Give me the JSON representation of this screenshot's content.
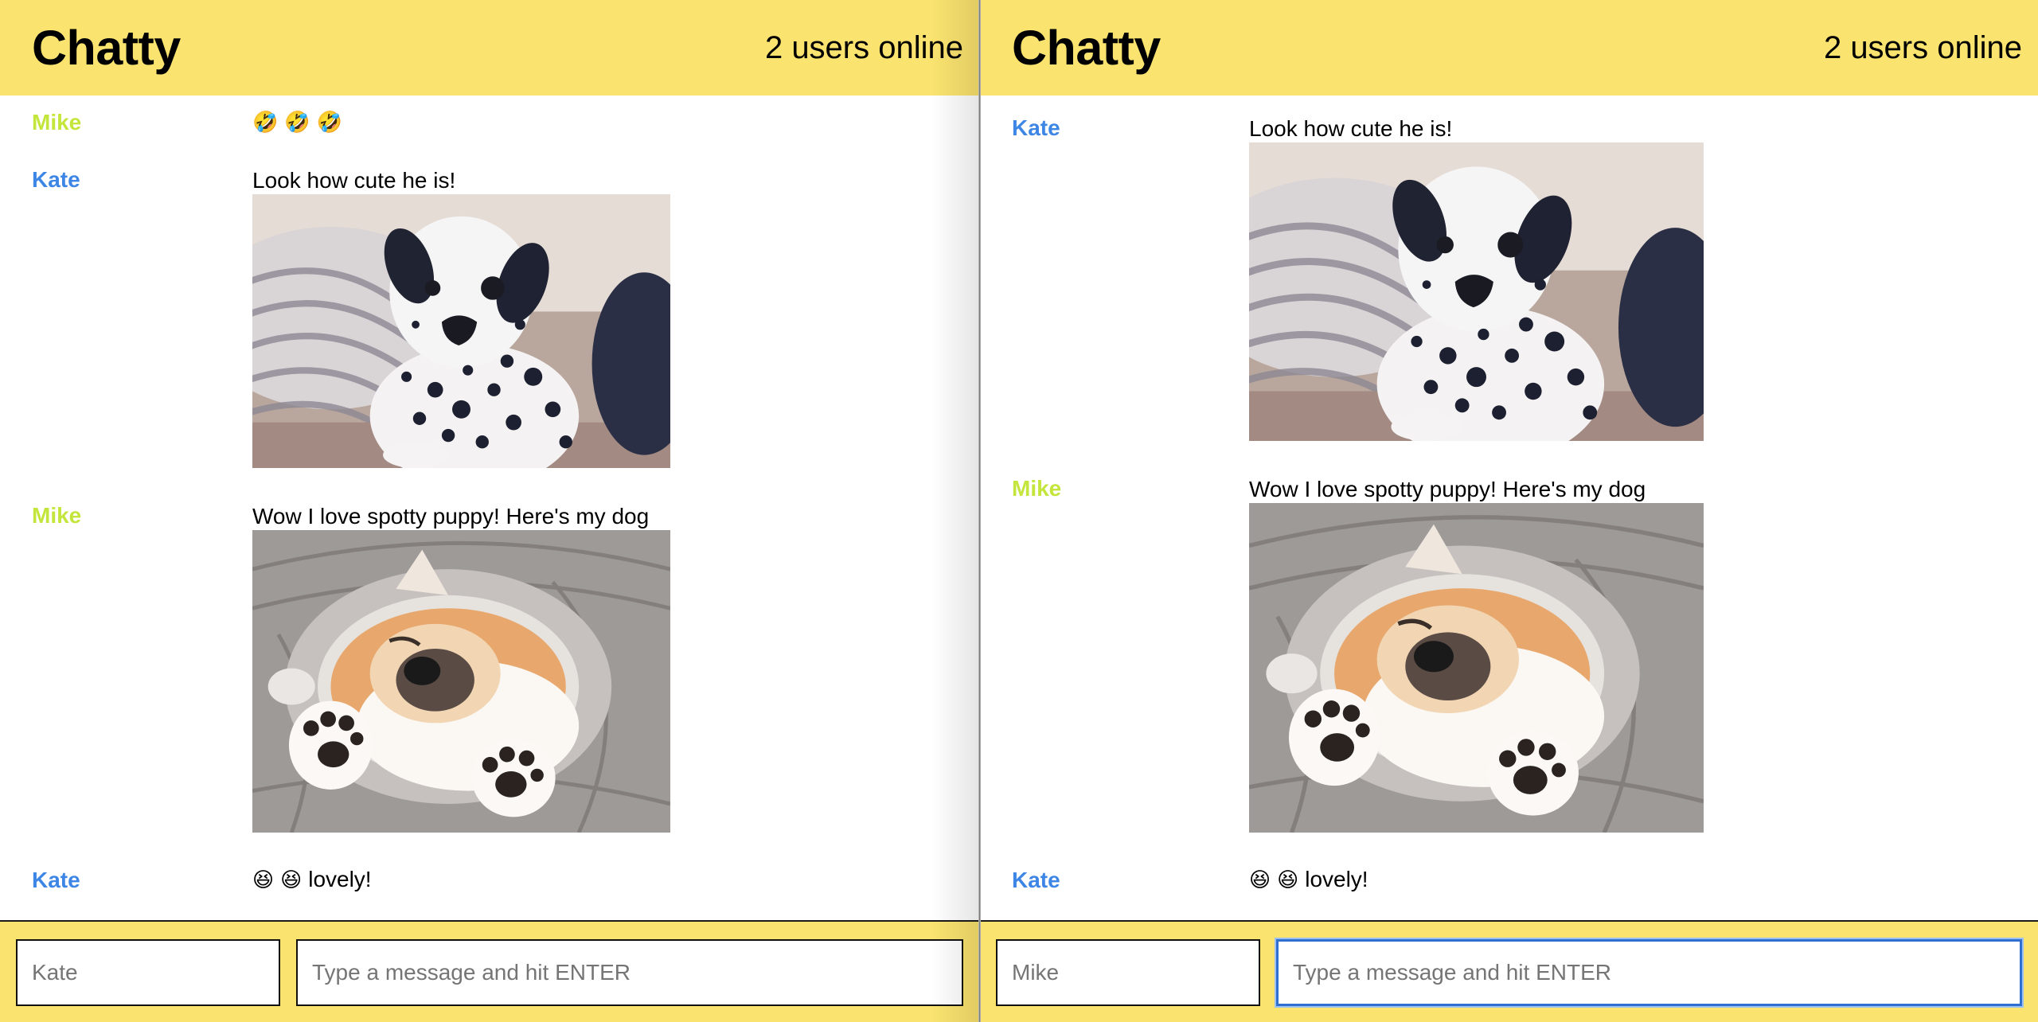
{
  "left_window": {
    "navbar": {
      "brand": "Chatty",
      "online": "2 users online"
    },
    "messages": [
      {
        "user": "Mike",
        "emojis": [
          "🤣",
          "🤣",
          "🤣"
        ],
        "text": ""
      },
      {
        "user": "Kate",
        "text": "Look how cute he is!",
        "image": "dalmatian-puppy"
      },
      {
        "user": "Mike",
        "text": "Wow I love spotty puppy! Here's my dog",
        "image": "sleeping-shiba-puppy"
      },
      {
        "user": "Kate",
        "emojis": [
          "😆",
          "😆"
        ],
        "text": "lovely!"
      }
    ],
    "composer": {
      "username_placeholder": "Kate",
      "message_placeholder": "Type a message and hit ENTER"
    }
  },
  "right_window": {
    "navbar": {
      "brand": "Chatty",
      "online": "2 users online"
    },
    "messages": [
      {
        "user": "Kate",
        "text": "Look how cute he is!",
        "image": "dalmatian-puppy"
      },
      {
        "user": "Mike",
        "text": "Wow I love spotty puppy! Here's my dog",
        "image": "sleeping-shiba-puppy"
      },
      {
        "user": "Kate",
        "emojis": [
          "😆",
          "😆"
        ],
        "text": "lovely!"
      }
    ],
    "composer": {
      "username_placeholder": "Mike",
      "message_placeholder": "Type a message and hit ENTER"
    }
  },
  "colors": {
    "navbar": "#fae36f",
    "mike": "#c4e63c",
    "kate": "#3d86e6",
    "focus": "#2f6fd0"
  }
}
